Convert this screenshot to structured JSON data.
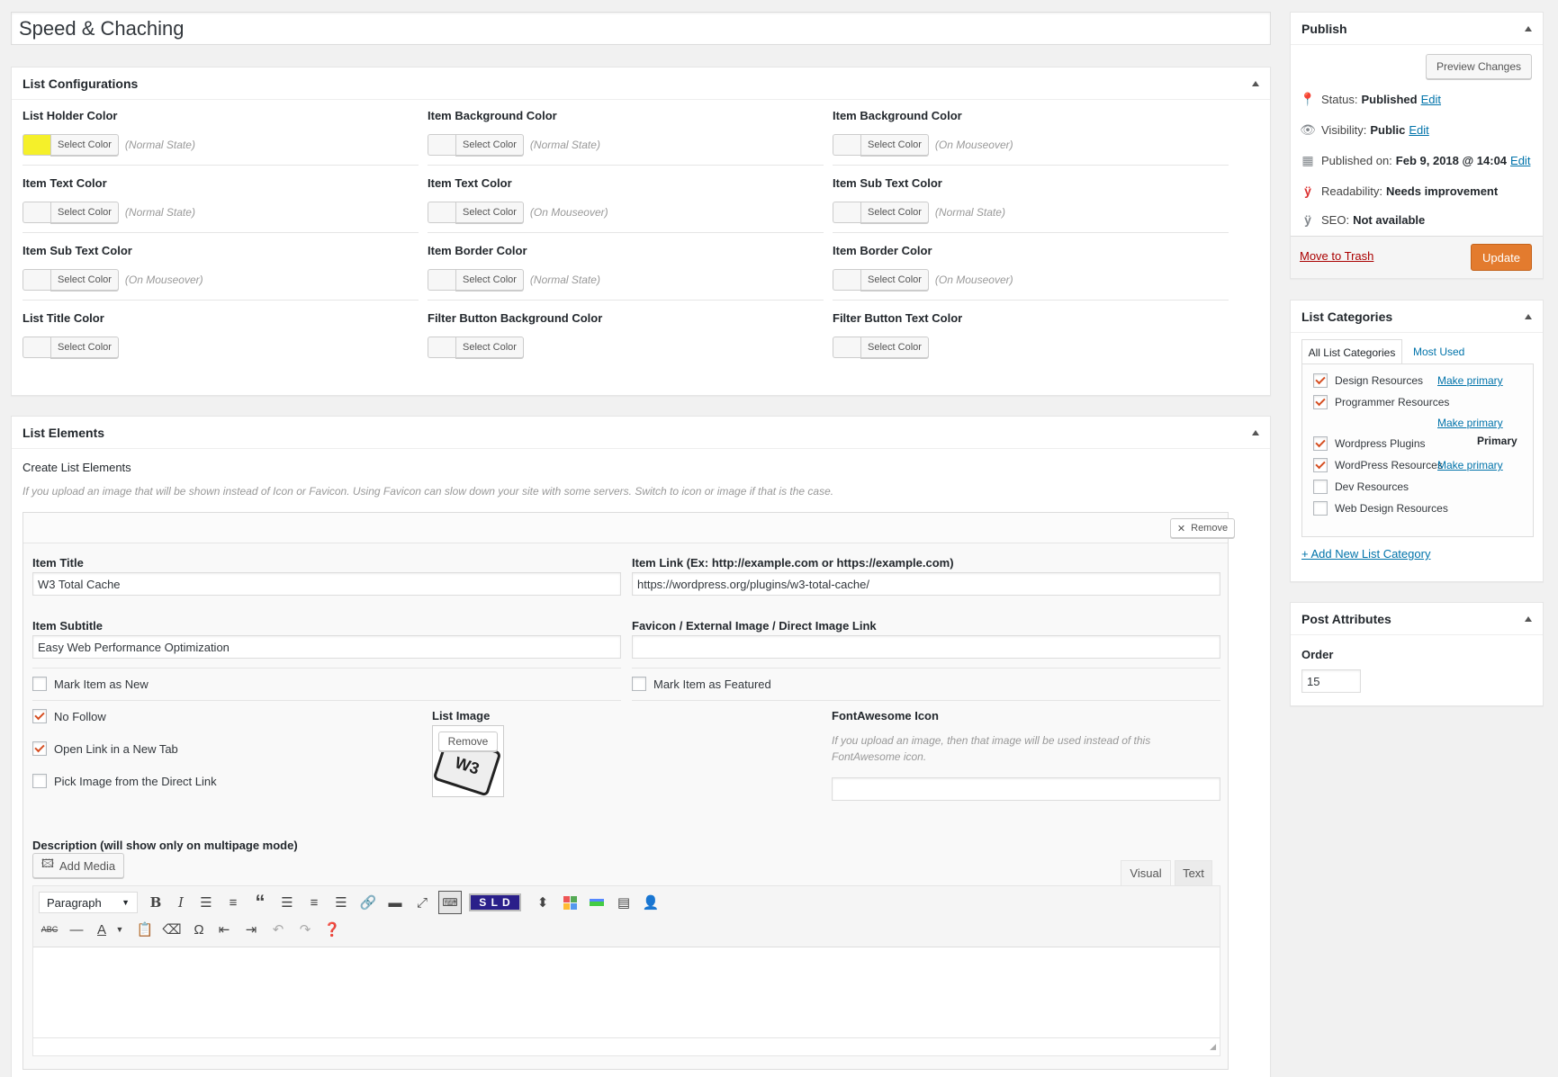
{
  "title_value": "Speed & Chaching",
  "list_config": {
    "heading": "List Configurations",
    "select_label": "Select Color",
    "fields": [
      {
        "label": "List Holder Color",
        "state": "(Normal State)",
        "color": "#f5f02a"
      },
      {
        "label": "Item Background Color",
        "state": "(Normal State)"
      },
      {
        "label": "Item Background Color",
        "state": "(On Mouseover)"
      },
      {
        "label": "Item Text Color",
        "state": "(Normal State)"
      },
      {
        "label": "Item Text Color",
        "state": "(On Mouseover)"
      },
      {
        "label": "Item Sub Text Color",
        "state": "(Normal State)"
      },
      {
        "label": "Item Sub Text Color",
        "state": "(On Mouseover)"
      },
      {
        "label": "Item Border Color",
        "state": "(Normal State)"
      },
      {
        "label": "Item Border Color",
        "state": "(On Mouseover)"
      },
      {
        "label": "List Title Color",
        "state": ""
      },
      {
        "label": "Filter Button Background Color",
        "state": ""
      },
      {
        "label": "Filter Button Text Color",
        "state": ""
      }
    ]
  },
  "list_elements": {
    "heading": "List Elements",
    "create_label": "Create List Elements",
    "help": "If you upload an image that will be shown instead of Icon or Favicon. Using Favicon can slow down your site with some servers. Switch to icon or image if that is the case.",
    "remove_label": "Remove",
    "item_title_label": "Item Title",
    "item_title_value": "W3 Total Cache",
    "item_link_label": "Item Link (Ex: http://example.com or https://example.com)",
    "item_link_value": "https://wordpress.org/plugins/w3-total-cache/",
    "item_subtitle_label": "Item Subtitle",
    "item_subtitle_value": "Easy Web Performance Optimization",
    "favicon_label": "Favicon / External Image / Direct Image Link",
    "favicon_value": "",
    "mark_new": "Mark Item as New",
    "mark_featured": "Mark Item as Featured",
    "no_follow": "No Follow",
    "new_tab": "Open Link in a New Tab",
    "pick_image": "Pick Image from the Direct Link",
    "list_image_label": "List Image",
    "image_remove": "Remove",
    "image_text": "W3",
    "fa_label": "FontAwesome Icon",
    "fa_help": "If you upload an image, then that image will be used instead of this FontAwesome icon.",
    "description_label": "Description (will show only on multipage mode)",
    "add_media": "Add Media",
    "tab_visual": "Visual",
    "tab_text": "Text",
    "format_select": "Paragraph",
    "sld_label": "S L D"
  },
  "publish": {
    "heading": "Publish",
    "preview": "Preview Changes",
    "status_label": "Status:",
    "status_value": "Published",
    "visibility_label": "Visibility:",
    "visibility_value": "Public",
    "published_label": "Published on:",
    "published_value": "Feb 9, 2018 @ 14:04",
    "edit": "Edit",
    "readability_label": "Readability:",
    "readability_value": "Needs improvement",
    "seo_label": "SEO:",
    "seo_value": "Not available",
    "trash": "Move to Trash",
    "update": "Update",
    "update_color": "#e37b2e"
  },
  "categories": {
    "heading": "List Categories",
    "tab_all": "All List Categories",
    "tab_most": "Most Used",
    "make_primary": "Make primary",
    "primary": "Primary",
    "items": [
      {
        "label": "Design Resources",
        "checked": true
      },
      {
        "label": "Programmer Resources",
        "checked": true
      },
      {
        "label": "Wordpress Plugins",
        "checked": true
      },
      {
        "label": "WordPress Resources",
        "checked": true
      },
      {
        "label": "Dev Resources",
        "checked": false
      },
      {
        "label": "Web Design Resources",
        "checked": false
      }
    ],
    "add_new": "+ Add New List Category"
  },
  "attributes": {
    "heading": "Post Attributes",
    "order_label": "Order",
    "order_value": "15"
  }
}
